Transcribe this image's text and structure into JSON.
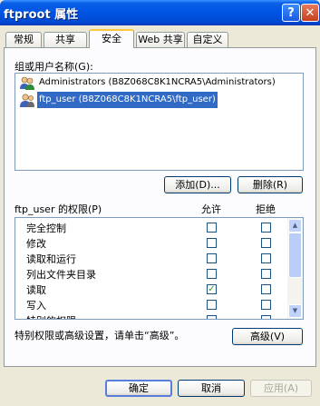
{
  "window": {
    "title": "ftproot 属性",
    "help_label": "?",
    "close_label": "✕"
  },
  "tabs": [
    {
      "label": "常规",
      "active": false
    },
    {
      "label": "共享",
      "active": false
    },
    {
      "label": "安全",
      "active": true
    },
    {
      "label": "Web 共享",
      "active": false
    },
    {
      "label": "自定义",
      "active": false
    }
  ],
  "users": {
    "label": "组或用户名称(G):",
    "items": [
      {
        "name": "Administrators (B8Z068C8K1NCRA5\\Administrators)",
        "selected": false
      },
      {
        "name": "ftp_user (B8Z068C8K1NCRA5\\ftp_user)",
        "selected": true
      }
    ],
    "add_button": "添加(D)...",
    "remove_button": "删除(R)"
  },
  "permissions": {
    "label": "ftp_user 的权限(P)",
    "allow_header": "允许",
    "deny_header": "拒绝",
    "rows": [
      {
        "name": "完全控制",
        "allow": false,
        "deny": false
      },
      {
        "name": "修改",
        "allow": false,
        "deny": false
      },
      {
        "name": "读取和运行",
        "allow": false,
        "deny": false
      },
      {
        "name": "列出文件夹目录",
        "allow": false,
        "deny": false
      },
      {
        "name": "读取",
        "allow": true,
        "deny": false
      },
      {
        "name": "写入",
        "allow": false,
        "deny": false
      },
      {
        "name": "特别的权限",
        "allow": false,
        "deny": false
      }
    ],
    "check_glyph": "✓"
  },
  "advanced": {
    "hint": "特别权限或高级设置，请单击“高级”。",
    "button": "高级(V)"
  },
  "footer": {
    "ok": "确定",
    "cancel": "取消",
    "apply": "应用(A)"
  }
}
